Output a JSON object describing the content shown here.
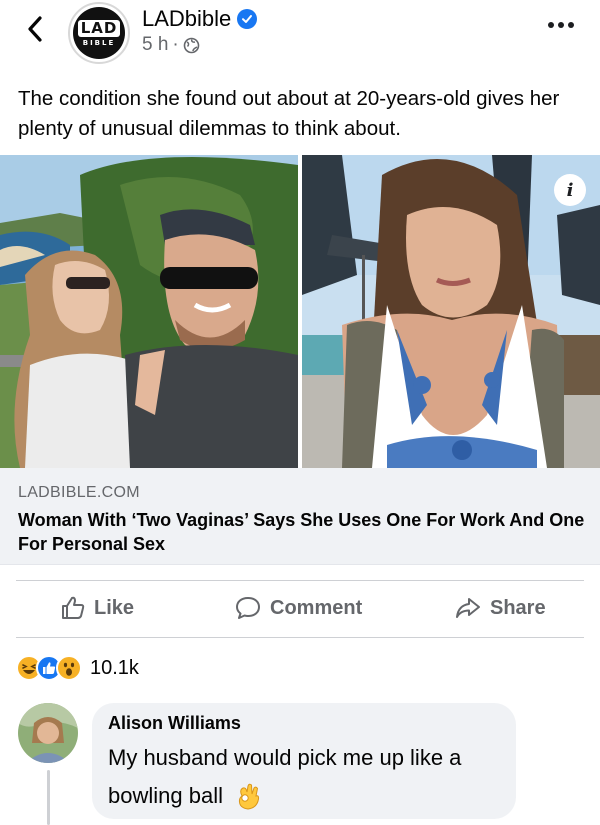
{
  "post": {
    "page_name": "LADbible",
    "logo_text_top": "LAD",
    "logo_text_bottom": "BIBLE",
    "time": "5 h",
    "separator": "·",
    "audience_icon": "globe-icon",
    "caption": "The condition she found out about at 20-years-old gives her plenty of unusual dilemmas to think about."
  },
  "link_preview": {
    "domain": "LADBIBLE.COM",
    "title": "Woman With ‘Two Vaginas’ Says She Uses One For Work And One For Personal Sex",
    "info_label": "i"
  },
  "actions": {
    "like_label": "Like",
    "comment_label": "Comment",
    "share_label": "Share"
  },
  "reactions": {
    "types": [
      "haha",
      "like",
      "wow"
    ],
    "count": "10.1k"
  },
  "comment": {
    "author": "Alison Williams",
    "text": "My husband would pick me up like a bowling ball"
  },
  "colors": {
    "accent": "#1877f2",
    "secondary_text": "#65676b",
    "bubble_bg": "#f0f2f5",
    "reaction_yellow": "#f7b125"
  }
}
